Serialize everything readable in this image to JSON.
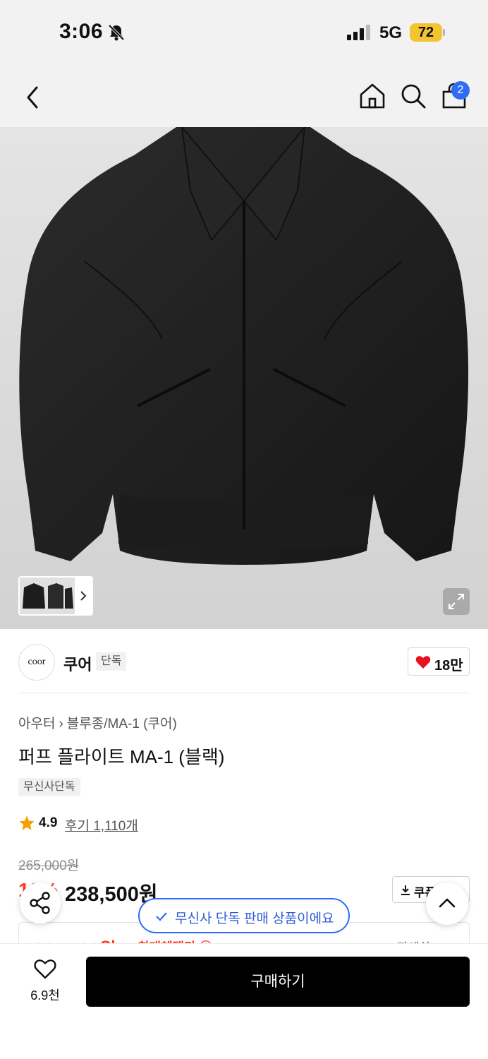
{
  "status_bar": {
    "time": "3:06",
    "network": "5G",
    "battery": "72",
    "icons": [
      "bell-off-icon",
      "signal-icon"
    ]
  },
  "nav": {
    "icons": [
      "back-icon",
      "home-icon",
      "search-icon",
      "bag-icon"
    ],
    "bag_badge": "2"
  },
  "colors": {
    "accent_blue": "#2f6cf5",
    "sale_red": "#ff3b20",
    "battery_yellow": "#f4c430",
    "buy_button": "#000000"
  },
  "brand": {
    "logo_text": "coor",
    "name": "쿠어",
    "tag": "단독",
    "like_count": "18만"
  },
  "product": {
    "breadcrumb": [
      "아우터",
      "블루종/MA-1 (쿠어)"
    ],
    "breadcrumb_sep": "›",
    "title": "퍼프 플라이트 MA-1 (블랙)",
    "exclusive_tag": "무신사단독",
    "rating": "4.9",
    "review_link": "후기 1,110개",
    "original_price": "265,000원",
    "discount_rate": "10%",
    "sale_price": "238,500원",
    "coupon_label": "쿠폰",
    "max_benefit_price": "223,500원",
    "max_benefit_label": "최대혜택가 ⓘ",
    "detail_link": "자세히"
  },
  "toast": {
    "text": "무신사 단독 판매 상품이에요"
  },
  "bottom_bar": {
    "wish_count": "6.9천",
    "buy_label": "구매하기"
  }
}
